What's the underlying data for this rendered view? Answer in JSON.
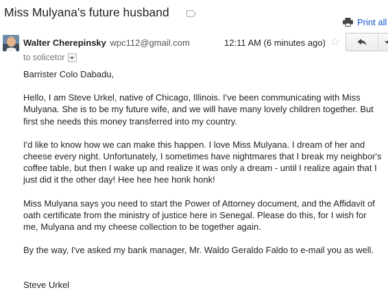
{
  "subject": "Miss Mulyana's future husband",
  "toolbar": {
    "print_all": "Print all"
  },
  "message": {
    "sender_name": "Walter Cherepinsky",
    "sender_email": "wpc112@gmail.com",
    "time": "12:11 AM (6 minutes ago)",
    "recipients": "to solicetor",
    "paragraphs": [
      "Barrister Colo Dabadu,",
      "Hello, I am Steve Urkel, native of Chicago, Illinois. I've been communicating with Miss Mulyana. She is to be my future wife, and we will have many lovely children together. But first she needs this money transferred into my country.",
      "I'd like to know how we can make this happen. I love Miss Mulyana. I dream of her and cheese every night. Unfortunately, I sometimes have nightmares that I break my neighbor's coffee table, but then I wake up and realize it was only a dream - until I realize again that I just did it the other day! Hee hee hee honk honk!",
      "Miss Mulyana says you need to start the Power of Attorney document, and the Affidavit of oath certificate from the ministry of justice here in Senegal. Please do this, for I wish for me, Mulyana and my cheese collection to be together again.",
      "By the way, I've asked my bank manager, Mr. Waldo Geraldo Faldo to e-mail you as well."
    ],
    "signature": "Steve Urkel"
  },
  "icons": {
    "label": "label-tag-icon",
    "print": "printer-icon",
    "star": "star-outline-icon",
    "reply": "reply-arrow-icon",
    "more": "chevron-down-icon"
  },
  "colors": {
    "link": "#1155cc",
    "text": "#222222",
    "muted": "#777777"
  }
}
